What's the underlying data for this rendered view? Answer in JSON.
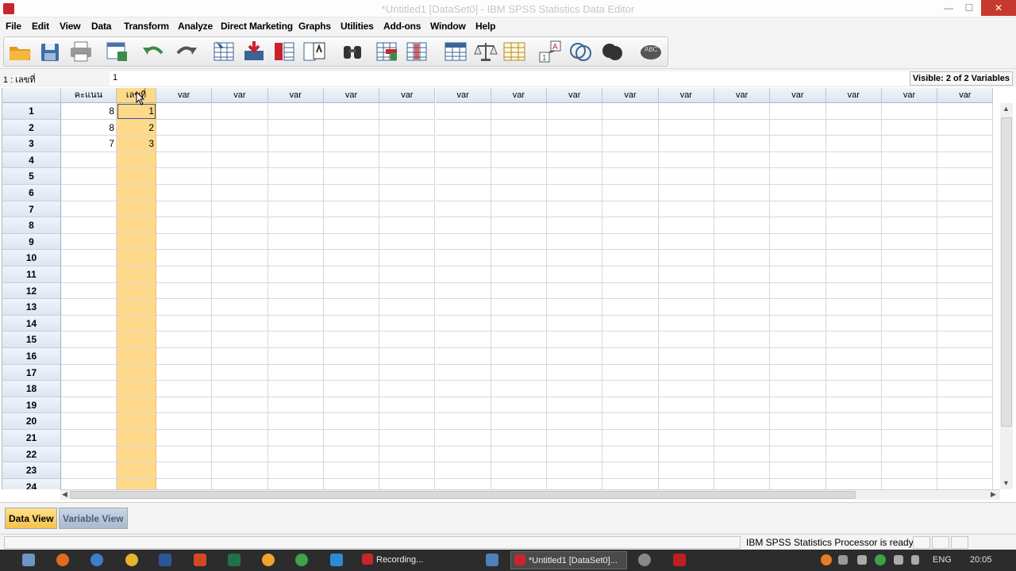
{
  "window": {
    "title": "*Untitled1 [DataSet0] - IBM SPSS Statistics Data Editor",
    "minimize": "—",
    "maximize": "☐",
    "close": "✕"
  },
  "menu": [
    "File",
    "Edit",
    "View",
    "Data",
    "Transform",
    "Analyze",
    "Direct Marketing",
    "Graphs",
    "Utilities",
    "Add-ons",
    "Window",
    "Help"
  ],
  "toolbar_icons": [
    "open-icon",
    "save-icon",
    "print-icon",
    "dialog-recall-icon",
    "undo-icon",
    "redo-icon",
    "goto-case-icon",
    "goto-variable-icon",
    "variables-icon",
    "run-descriptives-icon",
    "find-icon",
    "insert-cases-icon",
    "insert-variable-icon",
    "split-file-icon",
    "weight-cases-icon",
    "select-cases-icon",
    "value-labels-icon",
    "use-variable-sets-icon",
    "show-all-variables-icon",
    "spelling-icon"
  ],
  "editbar": {
    "cell_ref": "1 : เลขที่",
    "cell_value": "1",
    "visible": "Visible: 2 of 2 Variables"
  },
  "grid": {
    "columns": [
      "คะแนน",
      "เลขที่",
      "var",
      "var",
      "var",
      "var",
      "var",
      "var",
      "var",
      "var",
      "var",
      "var",
      "var",
      "var",
      "var",
      "var",
      "var"
    ],
    "selected_column": 1,
    "rows": [
      [
        "8",
        "1"
      ],
      [
        "8",
        "2"
      ],
      [
        "7",
        "3"
      ]
    ],
    "row_numbers": [
      "1",
      "2",
      "3",
      "4",
      "5",
      "6",
      "7",
      "8",
      "9",
      "10",
      "11",
      "12",
      "13",
      "14",
      "15",
      "16",
      "17",
      "18",
      "19",
      "20",
      "21",
      "22",
      "23",
      "24"
    ]
  },
  "tabs": {
    "data_view": "Data View",
    "variable_view": "Variable View"
  },
  "status": {
    "processor": "IBM SPSS Statistics Processor is ready"
  },
  "taskbar": {
    "recording": "Recording...",
    "spss_window": "*Untitled1 [DataSet0]...",
    "lang": "ENG",
    "time": "20:05"
  },
  "colors": {
    "selected_column": "#ffd98a",
    "header": "#dde6f1",
    "active_tab": "#f6c34a"
  }
}
